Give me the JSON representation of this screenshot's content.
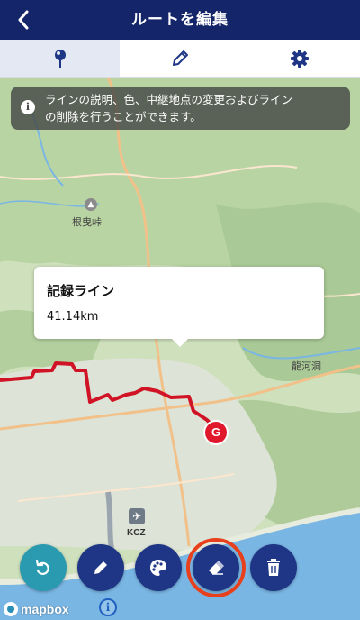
{
  "header": {
    "title": "ルートを編集",
    "back_label": "<"
  },
  "tabs": [
    {
      "name": "pin",
      "icon": "pin-icon",
      "active": true
    },
    {
      "name": "pencil",
      "icon": "pencil-icon",
      "active": false
    },
    {
      "name": "settings",
      "icon": "gear-icon",
      "active": false
    }
  ],
  "info": {
    "icon_label": "i",
    "line1": "ラインの説明、色、中継地点の変更およびライン",
    "line2": "の削除を行うことができます。"
  },
  "popup": {
    "title": "記録ライン",
    "distance": "41.14km"
  },
  "map_labels": {
    "peak": "根曳峠",
    "cave": "龍河洞",
    "airport_code": "KCZ",
    "goal_marker": "G"
  },
  "toolbar": {
    "buttons": [
      {
        "name": "undo",
        "icon": "undo-icon"
      },
      {
        "name": "edit",
        "icon": "pencil-icon"
      },
      {
        "name": "color",
        "icon": "palette-icon"
      },
      {
        "name": "eraser",
        "icon": "eraser-icon",
        "highlighted": true
      },
      {
        "name": "delete",
        "icon": "trash-icon"
      }
    ]
  },
  "attribution": {
    "logo_text": "mapbox",
    "info_label": "i"
  },
  "colors": {
    "header": "#14256a",
    "route": "#d01426",
    "teal": "#2a9ab0",
    "navy": "#1e3685",
    "highlight": "#e8401c"
  }
}
